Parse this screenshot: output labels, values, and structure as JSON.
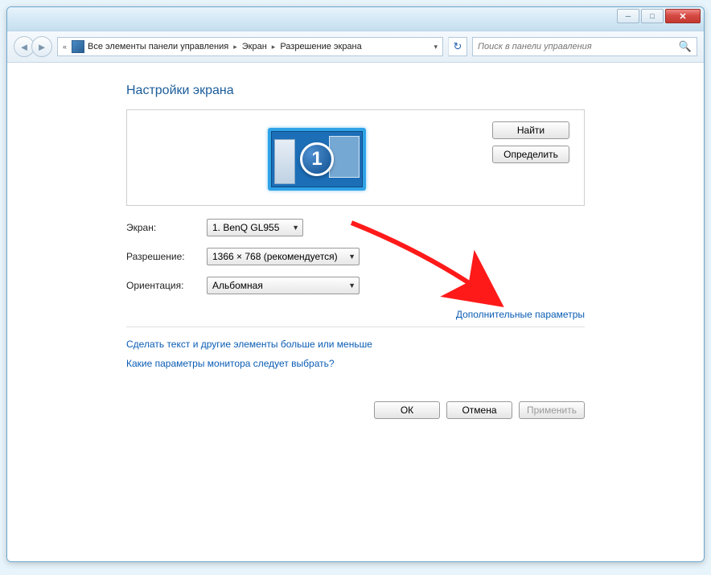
{
  "window_controls": {
    "minimize": "─",
    "maximize": "□",
    "close": "✕"
  },
  "breadcrumb": {
    "prefix": "«",
    "item1": "Все элементы панели управления",
    "item2": "Экран",
    "item3": "Разрешение экрана",
    "refresh_icon": "↻"
  },
  "search": {
    "placeholder": "Поиск в панели управления",
    "icon": "🔍"
  },
  "page_title": "Настройки экрана",
  "preview": {
    "monitor_number": "1",
    "find_button": "Найти",
    "detect_button": "Определить"
  },
  "form": {
    "display_label": "Экран:",
    "display_value": "1. BenQ GL955",
    "resolution_label": "Разрешение:",
    "resolution_value": "1366 × 768 (рекомендуется)",
    "orientation_label": "Ориентация:",
    "orientation_value": "Альбомная"
  },
  "links": {
    "advanced": "Дополнительные параметры",
    "help1": "Сделать текст и другие элементы больше или меньше",
    "help2": "Какие параметры монитора следует выбрать?"
  },
  "buttons": {
    "ok": "ОК",
    "cancel": "Отмена",
    "apply": "Применить"
  }
}
